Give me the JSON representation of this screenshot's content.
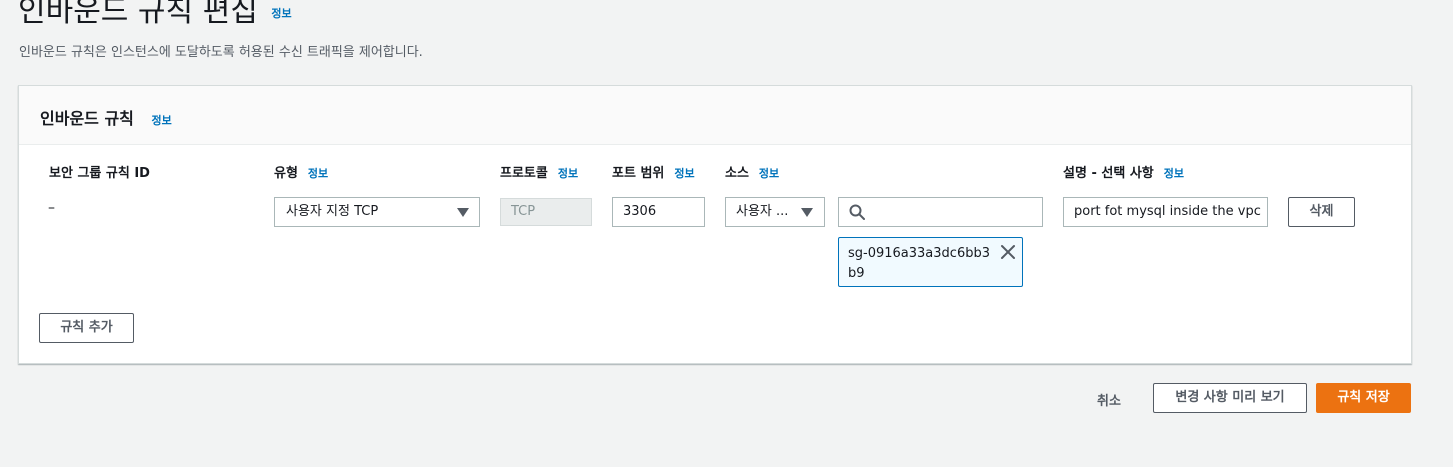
{
  "page": {
    "title": "인바운드 규칙 편집",
    "title_info": "정보",
    "description": "인바운드 규칙은 인스턴스에 도달하도록 허용된 수신 트래픽을 제어합니다."
  },
  "panel": {
    "title": "인바운드 규칙",
    "title_info": "정보",
    "columns": {
      "rule_id": "보안 그룹 규칙 ID",
      "type": "유형",
      "protocol": "프로토콜",
      "port_range": "포트 범위",
      "source": "소스",
      "description": "설명 - 선택 사항"
    },
    "info_label": "정보",
    "rule": {
      "rule_id": "–",
      "type": "사용자 지정 TCP",
      "protocol": "TCP",
      "port_range": "3306",
      "source_type": "사용자 ...",
      "source_search_value": "",
      "source_token": "sg-0916a33a3dc6bb3b9",
      "description": "port fot mysql inside the vpc",
      "delete_label": "삭제"
    },
    "add_rule_label": "규칙 추가"
  },
  "footer": {
    "cancel_label": "취소",
    "preview_label": "변경 사항 미리 보기",
    "save_label": "규칙 저장"
  },
  "colors": {
    "primary": "#ec7211",
    "link": "#0073bb",
    "background": "#f2f3f3"
  },
  "icons": {
    "search": "search-icon",
    "close": "close-icon",
    "caret": "caret-down-icon"
  }
}
